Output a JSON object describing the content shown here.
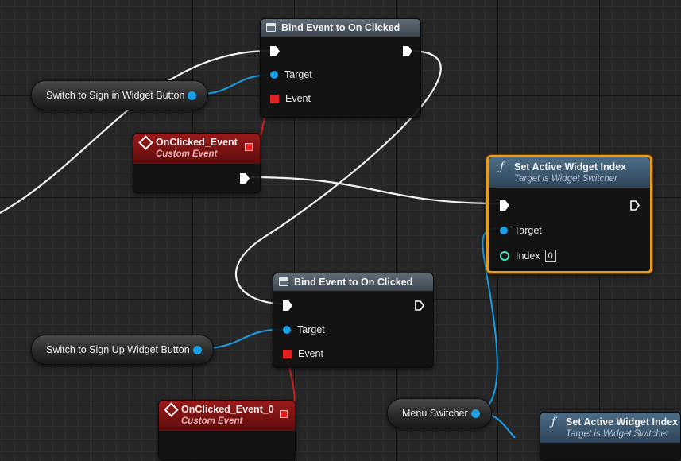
{
  "nodes": {
    "bind1": {
      "title": "Bind Event to On Clicked",
      "target_label": "Target",
      "event_label": "Event"
    },
    "bind2": {
      "title": "Bind Event to On Clicked",
      "target_label": "Target",
      "event_label": "Event"
    },
    "event1": {
      "title": "OnClicked_Event",
      "subtitle": "Custom Event"
    },
    "event2": {
      "title": "OnClicked_Event_0",
      "subtitle": "Custom Event"
    },
    "setidx1": {
      "title": "Set Active Widget Index",
      "subtitle": "Target is Widget Switcher",
      "target_label": "Target",
      "index_label": "Index",
      "index_value": "0"
    },
    "setidx2": {
      "title": "Set Active Widget Index",
      "subtitle": "Target is Widget Switcher"
    }
  },
  "variables": {
    "signin_button": "Switch to Sign in Widget Button",
    "signup_button": "Switch to Sign Up Widget Button",
    "menu_switcher": "Menu Switcher"
  },
  "icons": {
    "function": "function-icon",
    "event": "event-diamond-icon",
    "bind": "bind-node-icon",
    "exec": "exec-pin-icon",
    "object": "object-pin-icon",
    "integer": "integer-pin-icon",
    "delegate": "delegate-pin-icon"
  },
  "colors": {
    "object_pin": "#17a0e6",
    "delegate_pin": "#e32121",
    "integer_pin": "#47e2be",
    "selection": "#e89a18",
    "event_header": "#9a1a1a",
    "function_header": "#4d6d88"
  }
}
